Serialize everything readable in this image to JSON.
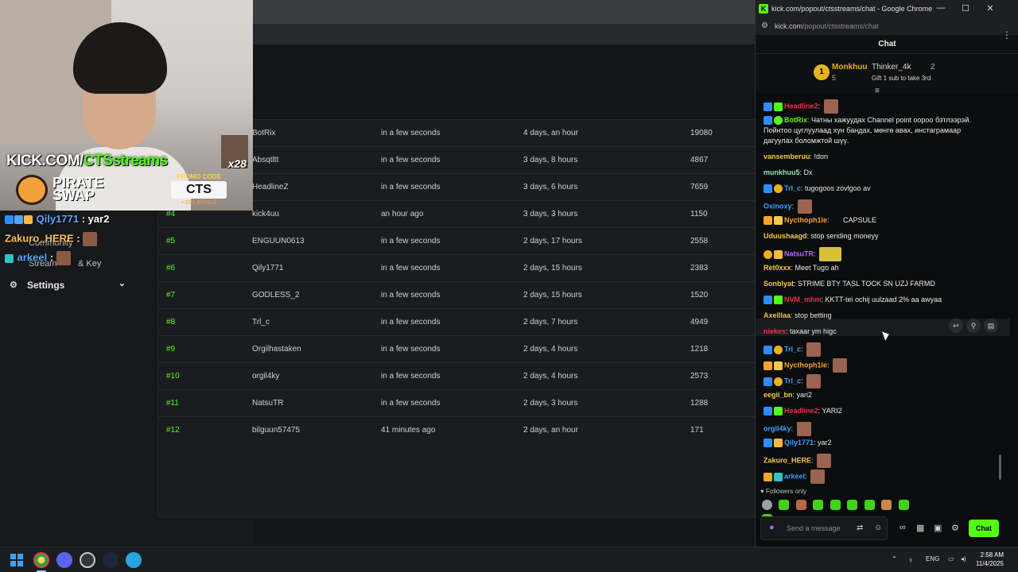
{
  "browser": {
    "window_title": "kick.com/popout/ctsstreams/chat - Google Chrome",
    "url_host": "kick.com",
    "url_path": "/popout/ctsstreams/chat",
    "controls": {
      "minimize": "—",
      "maximize": "☐",
      "close": "✕"
    }
  },
  "chat": {
    "header": "Chat",
    "leaderboard": {
      "first": {
        "rank": "1",
        "name": "Monkhuu",
        "count": "5"
      },
      "second": {
        "name": "Thinker_4k",
        "count": "2"
      },
      "gift_text": "Gift 1 sub to take 3rd"
    },
    "messages": [
      {
        "user": "Headline2",
        "color": "#e8334a",
        "text": ""
      },
      {
        "user": "BotRix",
        "color": "#53fc18",
        "text": "Чатны хажуудах Channel point оорoo бэтлээрэй."
      },
      {
        "user": "",
        "color": "#ececec",
        "text": "Пойнтоо цуглуулаад хүн бандах, мөнгө авах, инстаграмаар"
      },
      {
        "user": "",
        "color": "#ececec",
        "text": "дагуулах боломжтой шүү."
      },
      {
        "user": "vansemberuu",
        "color": "#f2c94c",
        "text": "!don"
      },
      {
        "user": "munkhuu5",
        "color": "#8be9a8",
        "text": "Dx"
      },
      {
        "user": "Trl_c",
        "color": "#3aa0ff",
        "text": "tugogoos zovlgoo av"
      },
      {
        "user": "Oxinoxy",
        "color": "#3aa0ff",
        "text": ""
      },
      {
        "user": "Nycthoph1le",
        "color": "#f6a623",
        "text": "CAPSULE"
      },
      {
        "user": "Uduushaagd",
        "color": "#f2c94c",
        "text": "stop sending moneyy"
      },
      {
        "user": "NatsuTR",
        "color": "#b36bff",
        "text": ""
      },
      {
        "user": "Ret0xxx",
        "color": "#f2c94c",
        "text": "Meet Tugo ah"
      },
      {
        "user": "Sonblyat",
        "color": "#f2c94c",
        "text": "STRIME BTY TASL TOCK SN UZJ FARMD"
      },
      {
        "user": "NVM_mhm",
        "color": "#e8334a",
        "text": "KKTT-tei ochij uulzaad 2% aa awyaa"
      },
      {
        "user": "Axelllaa",
        "color": "#f2c94c",
        "text": "stop betting"
      },
      {
        "user": "niekes",
        "color": "#e8334a",
        "text": "taxaar ym higc"
      },
      {
        "user": "Trl_c",
        "color": "#3aa0ff",
        "text": ""
      },
      {
        "user": "Nycthoph1le",
        "color": "#f6a623",
        "text": ""
      },
      {
        "user": "Trl_c",
        "color": "#3aa0ff",
        "text": ""
      },
      {
        "user": "eegii_bn",
        "color": "#f2c94c",
        "text": "yari2"
      },
      {
        "user": "Headline2",
        "color": "#e8334a",
        "text": "YARI2"
      },
      {
        "user": "orgil4ky",
        "color": "#3aa0ff",
        "text": ""
      },
      {
        "user": "Qily1771",
        "color": "#3aa0ff",
        "text": "yar2"
      },
      {
        "user": "Zakuro_HERE",
        "color": "#f2c94c",
        "text": ""
      },
      {
        "user": "arkeel",
        "color": "#3aa0ff",
        "text": ""
      }
    ],
    "followers_only": "Followers only",
    "composer_placeholder": "Send a message",
    "send_label": "Chat"
  },
  "leaderboard_table": {
    "rows": [
      {
        "rank": "",
        "name": "BotRix",
        "started": "in a few seconds",
        "duration": "4 days, an hour",
        "points": "19080"
      },
      {
        "rank": "",
        "name": "Absqtltt",
        "started": "in a few seconds",
        "duration": "3 days, 8 hours",
        "points": "4867"
      },
      {
        "rank": "",
        "name": "HeadlineZ",
        "started": "in a few seconds",
        "duration": "3 days, 6 hours",
        "points": "7659"
      },
      {
        "rank": "#4",
        "name": "kick4uu",
        "started": "an hour ago",
        "duration": "3 days, 3 hours",
        "points": "1150"
      },
      {
        "rank": "#5",
        "name": "ENGUUN0613",
        "started": "in a few seconds",
        "duration": "2 days, 17 hours",
        "points": "2558"
      },
      {
        "rank": "#6",
        "name": "Qily1771",
        "started": "in a few seconds",
        "duration": "2 days, 15 hours",
        "points": "2383"
      },
      {
        "rank": "#7",
        "name": "GODLESS_2",
        "started": "in a few seconds",
        "duration": "2 days, 15 hours",
        "points": "1520"
      },
      {
        "rank": "#8",
        "name": "Trl_c",
        "started": "in a few seconds",
        "duration": "2 days, 7 hours",
        "points": "4949"
      },
      {
        "rank": "#9",
        "name": "Orgilhastaken",
        "started": "in a few seconds",
        "duration": "2 days, 4 hours",
        "points": "1218"
      },
      {
        "rank": "#10",
        "name": "orgil4ky",
        "started": "in a few seconds",
        "duration": "2 days, 4 hours",
        "points": "2573"
      },
      {
        "rank": "#11",
        "name": "NatsuTR",
        "started": "in a few seconds",
        "duration": "2 days, 3 hours",
        "points": "1288"
      },
      {
        "rank": "#12",
        "name": "bilguun57475",
        "started": "41 minutes ago",
        "duration": "2 days, an hour",
        "points": "171"
      }
    ]
  },
  "sidebar": {
    "ghost_items": [
      "Community",
      "Stream",
      "& Key"
    ],
    "settings_label": "Settings"
  },
  "overlay": {
    "brand_prefix": "KICK.COM/",
    "brand_name": "CTSstreams",
    "sponsor_line1": "PIRATE",
    "sponsor_line2": "SWAP",
    "promo_heading": "PROMO CODE",
    "promo_code": "CTS",
    "promo_bonus": "+35% BONUS",
    "multiplier": "x28",
    "chat": [
      {
        "user": "Qily1771",
        "text": " : yar2"
      },
      {
        "user": "Zakuro_HERE",
        "text": " :"
      },
      {
        "user": "arkeel",
        "text": " :"
      }
    ]
  },
  "taskbar": {
    "tray_lang": "ENG",
    "time": "2:58 AM",
    "date": "11/4/2025"
  },
  "colors": {
    "kick_green": "#53fc18",
    "background": "#141517",
    "chat_bg": "#0b0c0d"
  }
}
